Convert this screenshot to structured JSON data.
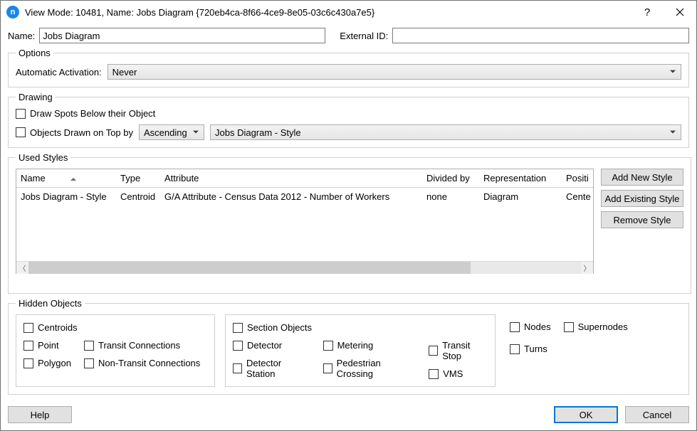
{
  "titlebar": {
    "title": "View Mode: 10481, Name: Jobs Diagram  {720eb4ca-8f66-4ce9-8e05-03c6c430a7e5}"
  },
  "fields": {
    "name_label": "Name:",
    "name_value": "Jobs Diagram",
    "extid_label": "External ID:",
    "extid_value": ""
  },
  "options": {
    "legend": "Options",
    "auto_act_label": "Automatic Activation:",
    "auto_act_value": "Never"
  },
  "drawing": {
    "legend": "Drawing",
    "spots_below_label": "Draw Spots Below their Object",
    "on_top_label": "Objects Drawn on Top by",
    "order_value": "Ascending",
    "style_value": "Jobs Diagram - Style"
  },
  "used": {
    "legend": "Used Styles",
    "headers": {
      "name": "Name",
      "type": "Type",
      "attr": "Attribute",
      "div": "Divided by",
      "rep": "Representation",
      "pos": "Positi"
    },
    "rows": [
      {
        "name": "Jobs Diagram - Style",
        "type": "Centroid",
        "attr": "G/A Attribute - Census Data 2012 - Number of Workers",
        "div": "none",
        "rep": "Diagram",
        "pos": "Cente"
      }
    ],
    "buttons": {
      "add_new": "Add New Style",
      "add_existing": "Add Existing Style",
      "remove": "Remove Style"
    }
  },
  "hidden": {
    "legend": "Hidden Objects",
    "centroids": "Centroids",
    "point": "Point",
    "polygon": "Polygon",
    "transit_conn": "Transit Connections",
    "nontransit_conn": "Non-Transit Connections",
    "section_obj": "Section Objects",
    "detector": "Detector",
    "detector_station": "Detector Station",
    "metering": "Metering",
    "ped_cross": "Pedestrian Crossing",
    "transit_stop": "Transit Stop",
    "vms": "VMS",
    "nodes": "Nodes",
    "supernodes": "Supernodes",
    "turns": "Turns"
  },
  "footer": {
    "help": "Help",
    "ok": "OK",
    "cancel": "Cancel"
  }
}
